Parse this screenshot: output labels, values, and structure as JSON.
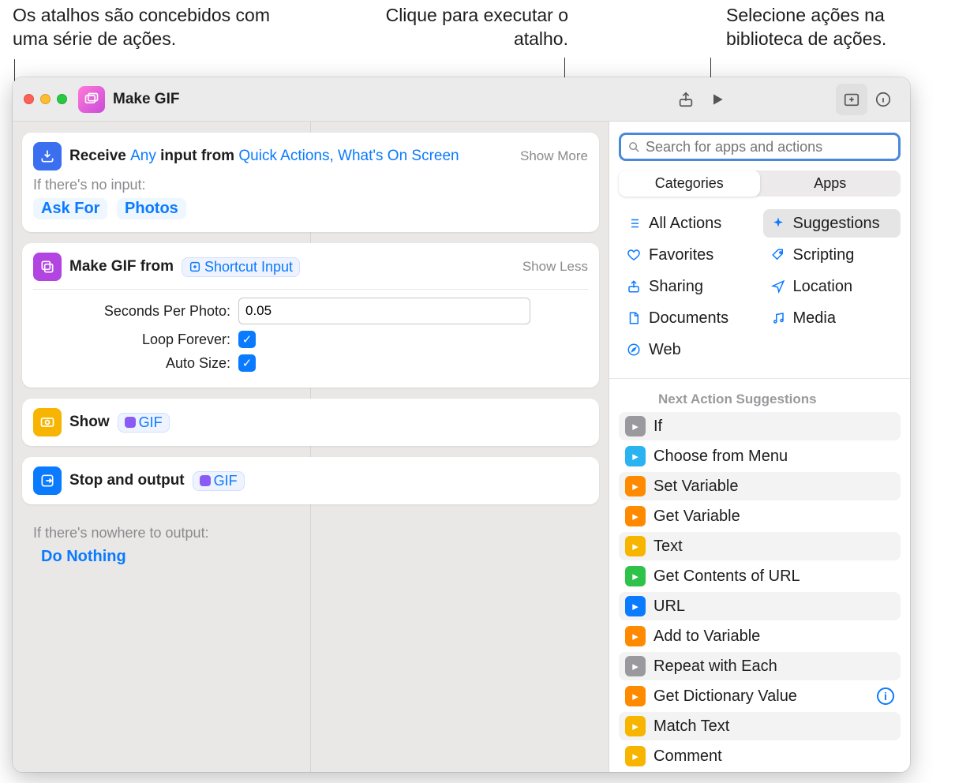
{
  "callouts": {
    "left": "Os atalhos são concebidos com uma série de ações.",
    "center": "Clique para executar o atalho.",
    "right": "Selecione ações na biblioteca de ações."
  },
  "window_title": "Make GIF",
  "editor": {
    "receive": {
      "word_receive": "Receive",
      "any": "Any",
      "input_from": "input from",
      "sources": "Quick Actions, What's On Screen",
      "show_toggle": "Show More",
      "no_input_label": "If there's no input:",
      "chip_ask": "Ask For",
      "chip_photos": "Photos"
    },
    "makegif": {
      "title": "Make GIF from",
      "variable": "Shortcut Input",
      "show_toggle": "Show Less",
      "seconds_label": "Seconds Per Photo:",
      "seconds_value": "0.05",
      "loop_label": "Loop Forever:",
      "auto_label": "Auto Size:"
    },
    "show": {
      "title": "Show",
      "variable": "GIF"
    },
    "output": {
      "title": "Stop and output",
      "variable": "GIF",
      "nowhere_label": "If there's nowhere to output:",
      "do_nothing": "Do Nothing"
    }
  },
  "sidebar": {
    "search_placeholder": "Search for apps and actions",
    "seg_categories": "Categories",
    "seg_apps": "Apps",
    "categories": [
      {
        "label": "All Actions",
        "icon": "list",
        "color": "#0a7aff"
      },
      {
        "label": "Suggestions",
        "icon": "sparkle",
        "color": "#0a7aff",
        "selected": true
      },
      {
        "label": "Favorites",
        "icon": "heart",
        "color": "#0a7aff"
      },
      {
        "label": "Scripting",
        "icon": "tag",
        "color": "#0a7aff"
      },
      {
        "label": "Sharing",
        "icon": "share",
        "color": "#0a7aff"
      },
      {
        "label": "Location",
        "icon": "nav",
        "color": "#0a7aff"
      },
      {
        "label": "Documents",
        "icon": "doc",
        "color": "#0a7aff"
      },
      {
        "label": "Media",
        "icon": "music",
        "color": "#0a7aff"
      },
      {
        "label": "Web",
        "icon": "safari",
        "color": "#0a7aff"
      }
    ],
    "suggestions_header": "Next Action Suggestions",
    "suggestions": [
      {
        "label": "If",
        "bg": "#9a9a9e"
      },
      {
        "label": "Choose from Menu",
        "bg": "#2bb2f0"
      },
      {
        "label": "Set Variable",
        "bg": "#ff8a00"
      },
      {
        "label": "Get Variable",
        "bg": "#ff8a00"
      },
      {
        "label": "Text",
        "bg": "#f7b500"
      },
      {
        "label": "Get Contents of URL",
        "bg": "#2ec24a"
      },
      {
        "label": "URL",
        "bg": "#0a7aff"
      },
      {
        "label": "Add to Variable",
        "bg": "#ff8a00"
      },
      {
        "label": "Repeat with Each",
        "bg": "#9a9a9e"
      },
      {
        "label": "Get Dictionary Value",
        "bg": "#ff8a00",
        "info": true
      },
      {
        "label": "Match Text",
        "bg": "#f7b500"
      },
      {
        "label": "Comment",
        "bg": "#f7b500"
      }
    ]
  }
}
